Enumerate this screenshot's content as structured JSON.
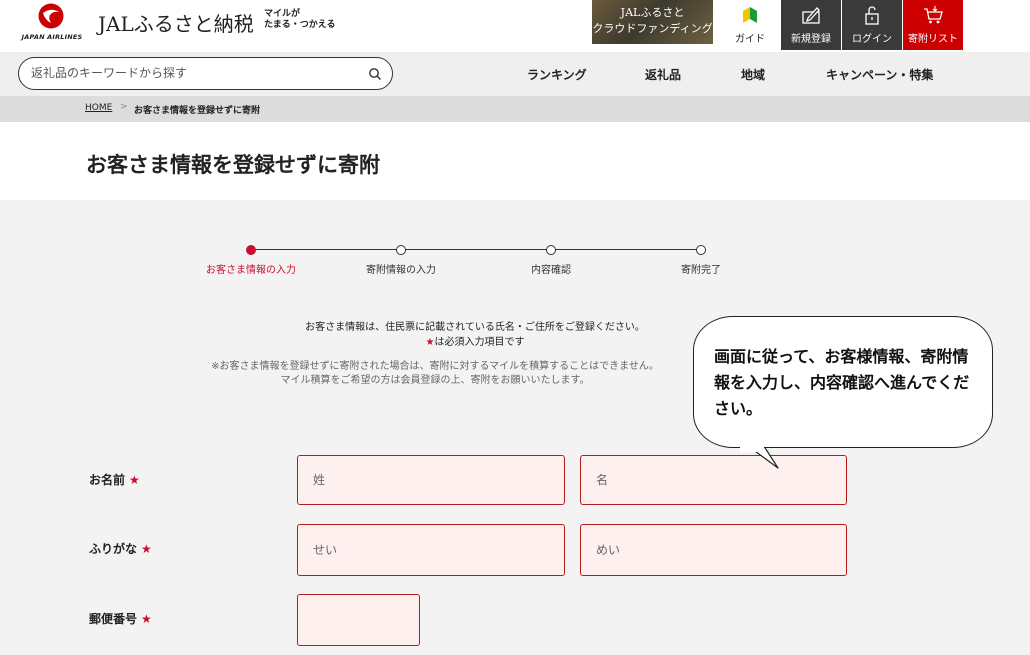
{
  "header": {
    "logo_text": "JAPAN AIRLINES",
    "site_title": "JALふるさと納税",
    "tagline_line1": "マイルが",
    "tagline_line2": "たまる・つかえる",
    "banner_line1": "JALふるさと",
    "banner_line2": "クラウドファンディング",
    "buttons": {
      "guide": "ガイド",
      "register": "新規登録",
      "login": "ログイン",
      "list": "寄附リスト"
    }
  },
  "nav": {
    "search_placeholder": "返礼品のキーワードから探す",
    "items": [
      "ランキング",
      "返礼品",
      "地域",
      "キャンペーン・特集"
    ]
  },
  "breadcrumb": {
    "home": "HOME",
    "separator": ">",
    "current": "お客さま情報を登録せずに寄附"
  },
  "page_title": "お客さま情報を登録せずに寄附",
  "steps": [
    {
      "label": "お客さま情報の入力",
      "active": true
    },
    {
      "label": "寄附情報の入力",
      "active": false
    },
    {
      "label": "内容確認",
      "active": false
    },
    {
      "label": "寄附完了",
      "active": false
    }
  ],
  "notice": {
    "line1": "お客さま情報は、住民票に記載されている氏名・ご住所をご登録ください。",
    "required_star": "★",
    "required_text": "は必須入力項目です",
    "sub_line1": "※お客さま情報を登録せずに寄附された場合は、寄附に対するマイルを積算することはできません。",
    "sub_line2": "マイル積算をご希望の方は会員登録の上、寄附をお願いいたします。"
  },
  "form": {
    "required_mark": "★",
    "name_label": "お名前",
    "last_name_placeholder": "姓",
    "first_name_placeholder": "名",
    "kana_label": "ふりがな",
    "last_kana_placeholder": "せい",
    "first_kana_placeholder": "めい",
    "postal_label": "郵便番号"
  },
  "bubble": {
    "text": "画面に従って、お客様情報、寄附情報を入力し、内容確認へ進んでください。"
  },
  "colors": {
    "accent": "#c8102e",
    "dark_button": "#3a3a3a",
    "input_bg": "#fff0f0"
  }
}
